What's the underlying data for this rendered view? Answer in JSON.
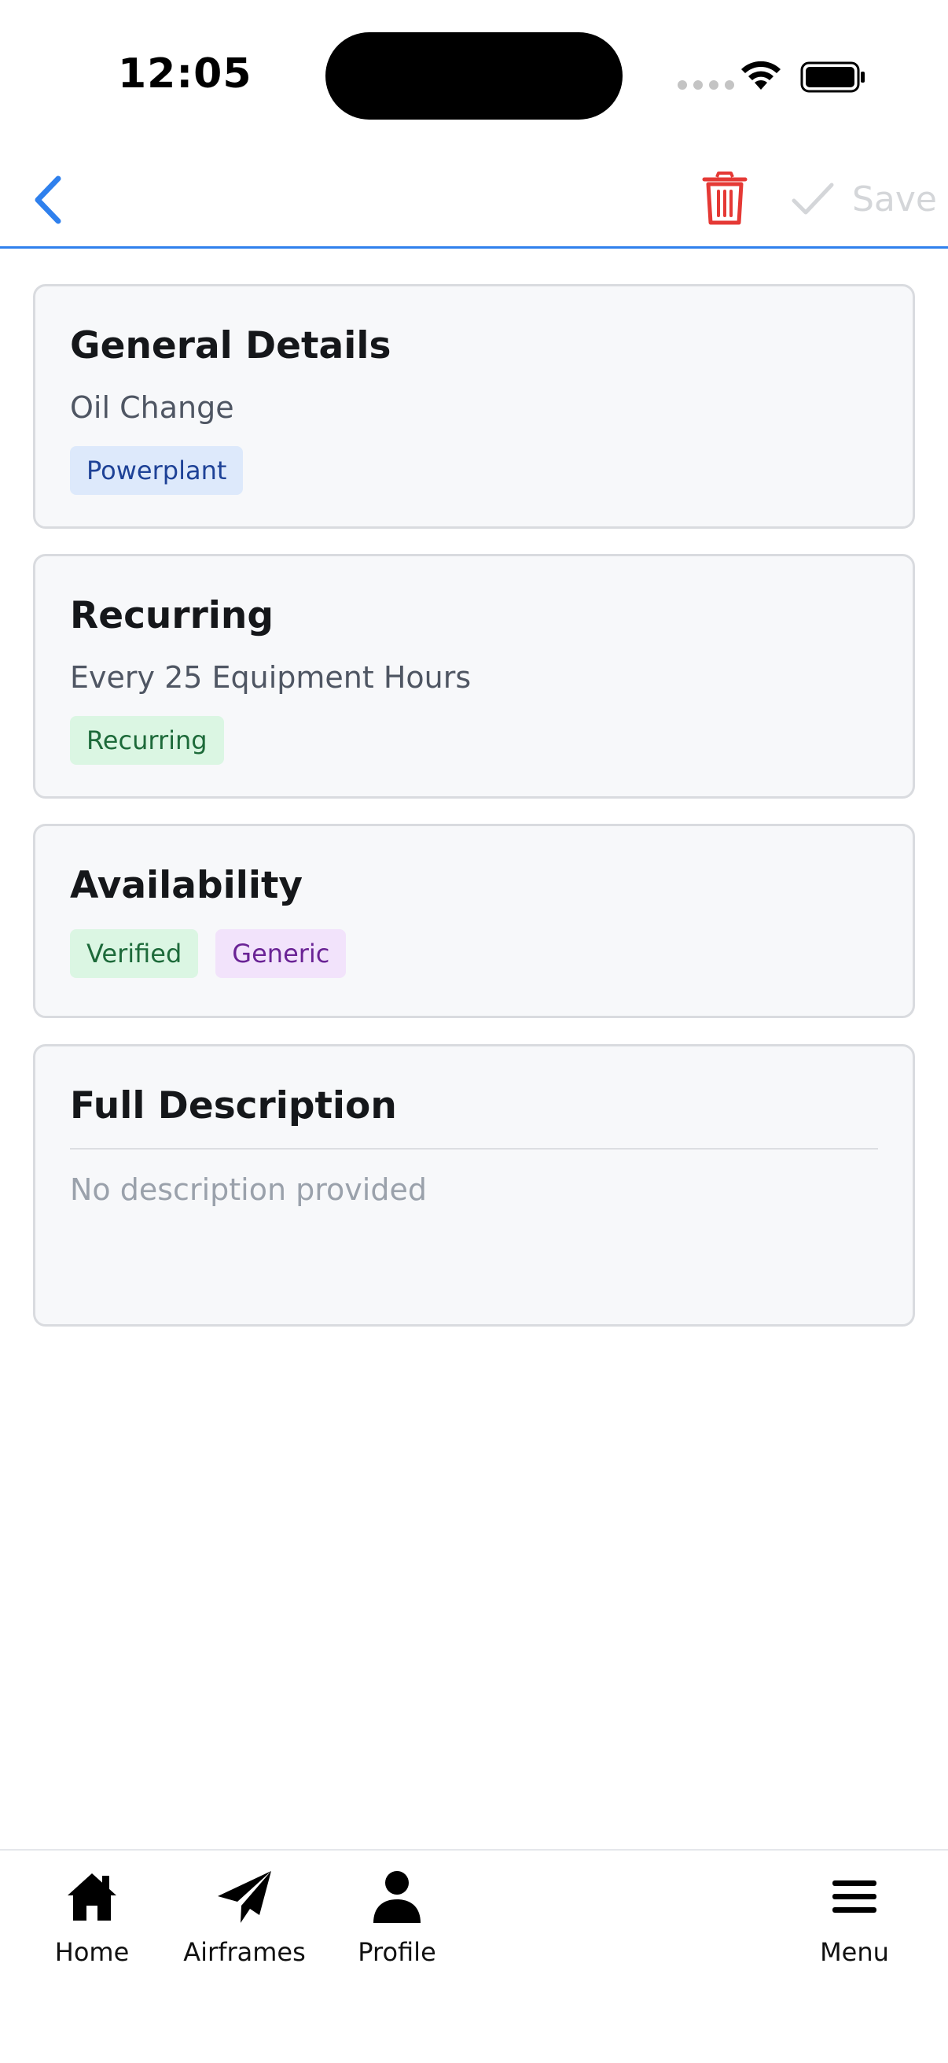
{
  "status_bar": {
    "time": "12:05",
    "icons": [
      "signal-icon",
      "wifi-icon",
      "battery-icon"
    ]
  },
  "top_bar": {
    "back_icon": "chevron-left-icon",
    "delete_icon": "trash-icon",
    "save_icon": "checkmark-icon",
    "save_label": "Save",
    "accent_color": "#2f80ed",
    "delete_color": "#e53935"
  },
  "cards": {
    "general": {
      "title": "General Details",
      "subtitle": "Oil Change",
      "tags": [
        "Powerplant"
      ]
    },
    "recurring": {
      "title": "Recurring",
      "subtitle": "Every 25 Equipment Hours",
      "tags": [
        "Recurring"
      ]
    },
    "availability": {
      "title": "Availability",
      "tags": [
        "Verified",
        "Generic"
      ]
    },
    "description": {
      "title": "Full Description",
      "body": "No description provided"
    }
  },
  "bottom_nav": {
    "items": [
      {
        "label": "Home",
        "icon": "home-icon"
      },
      {
        "label": "Airframes",
        "icon": "paper-plane-icon"
      },
      {
        "label": "Profile",
        "icon": "person-icon"
      },
      {
        "label": "Menu",
        "icon": "hamburger-menu-icon"
      }
    ]
  }
}
